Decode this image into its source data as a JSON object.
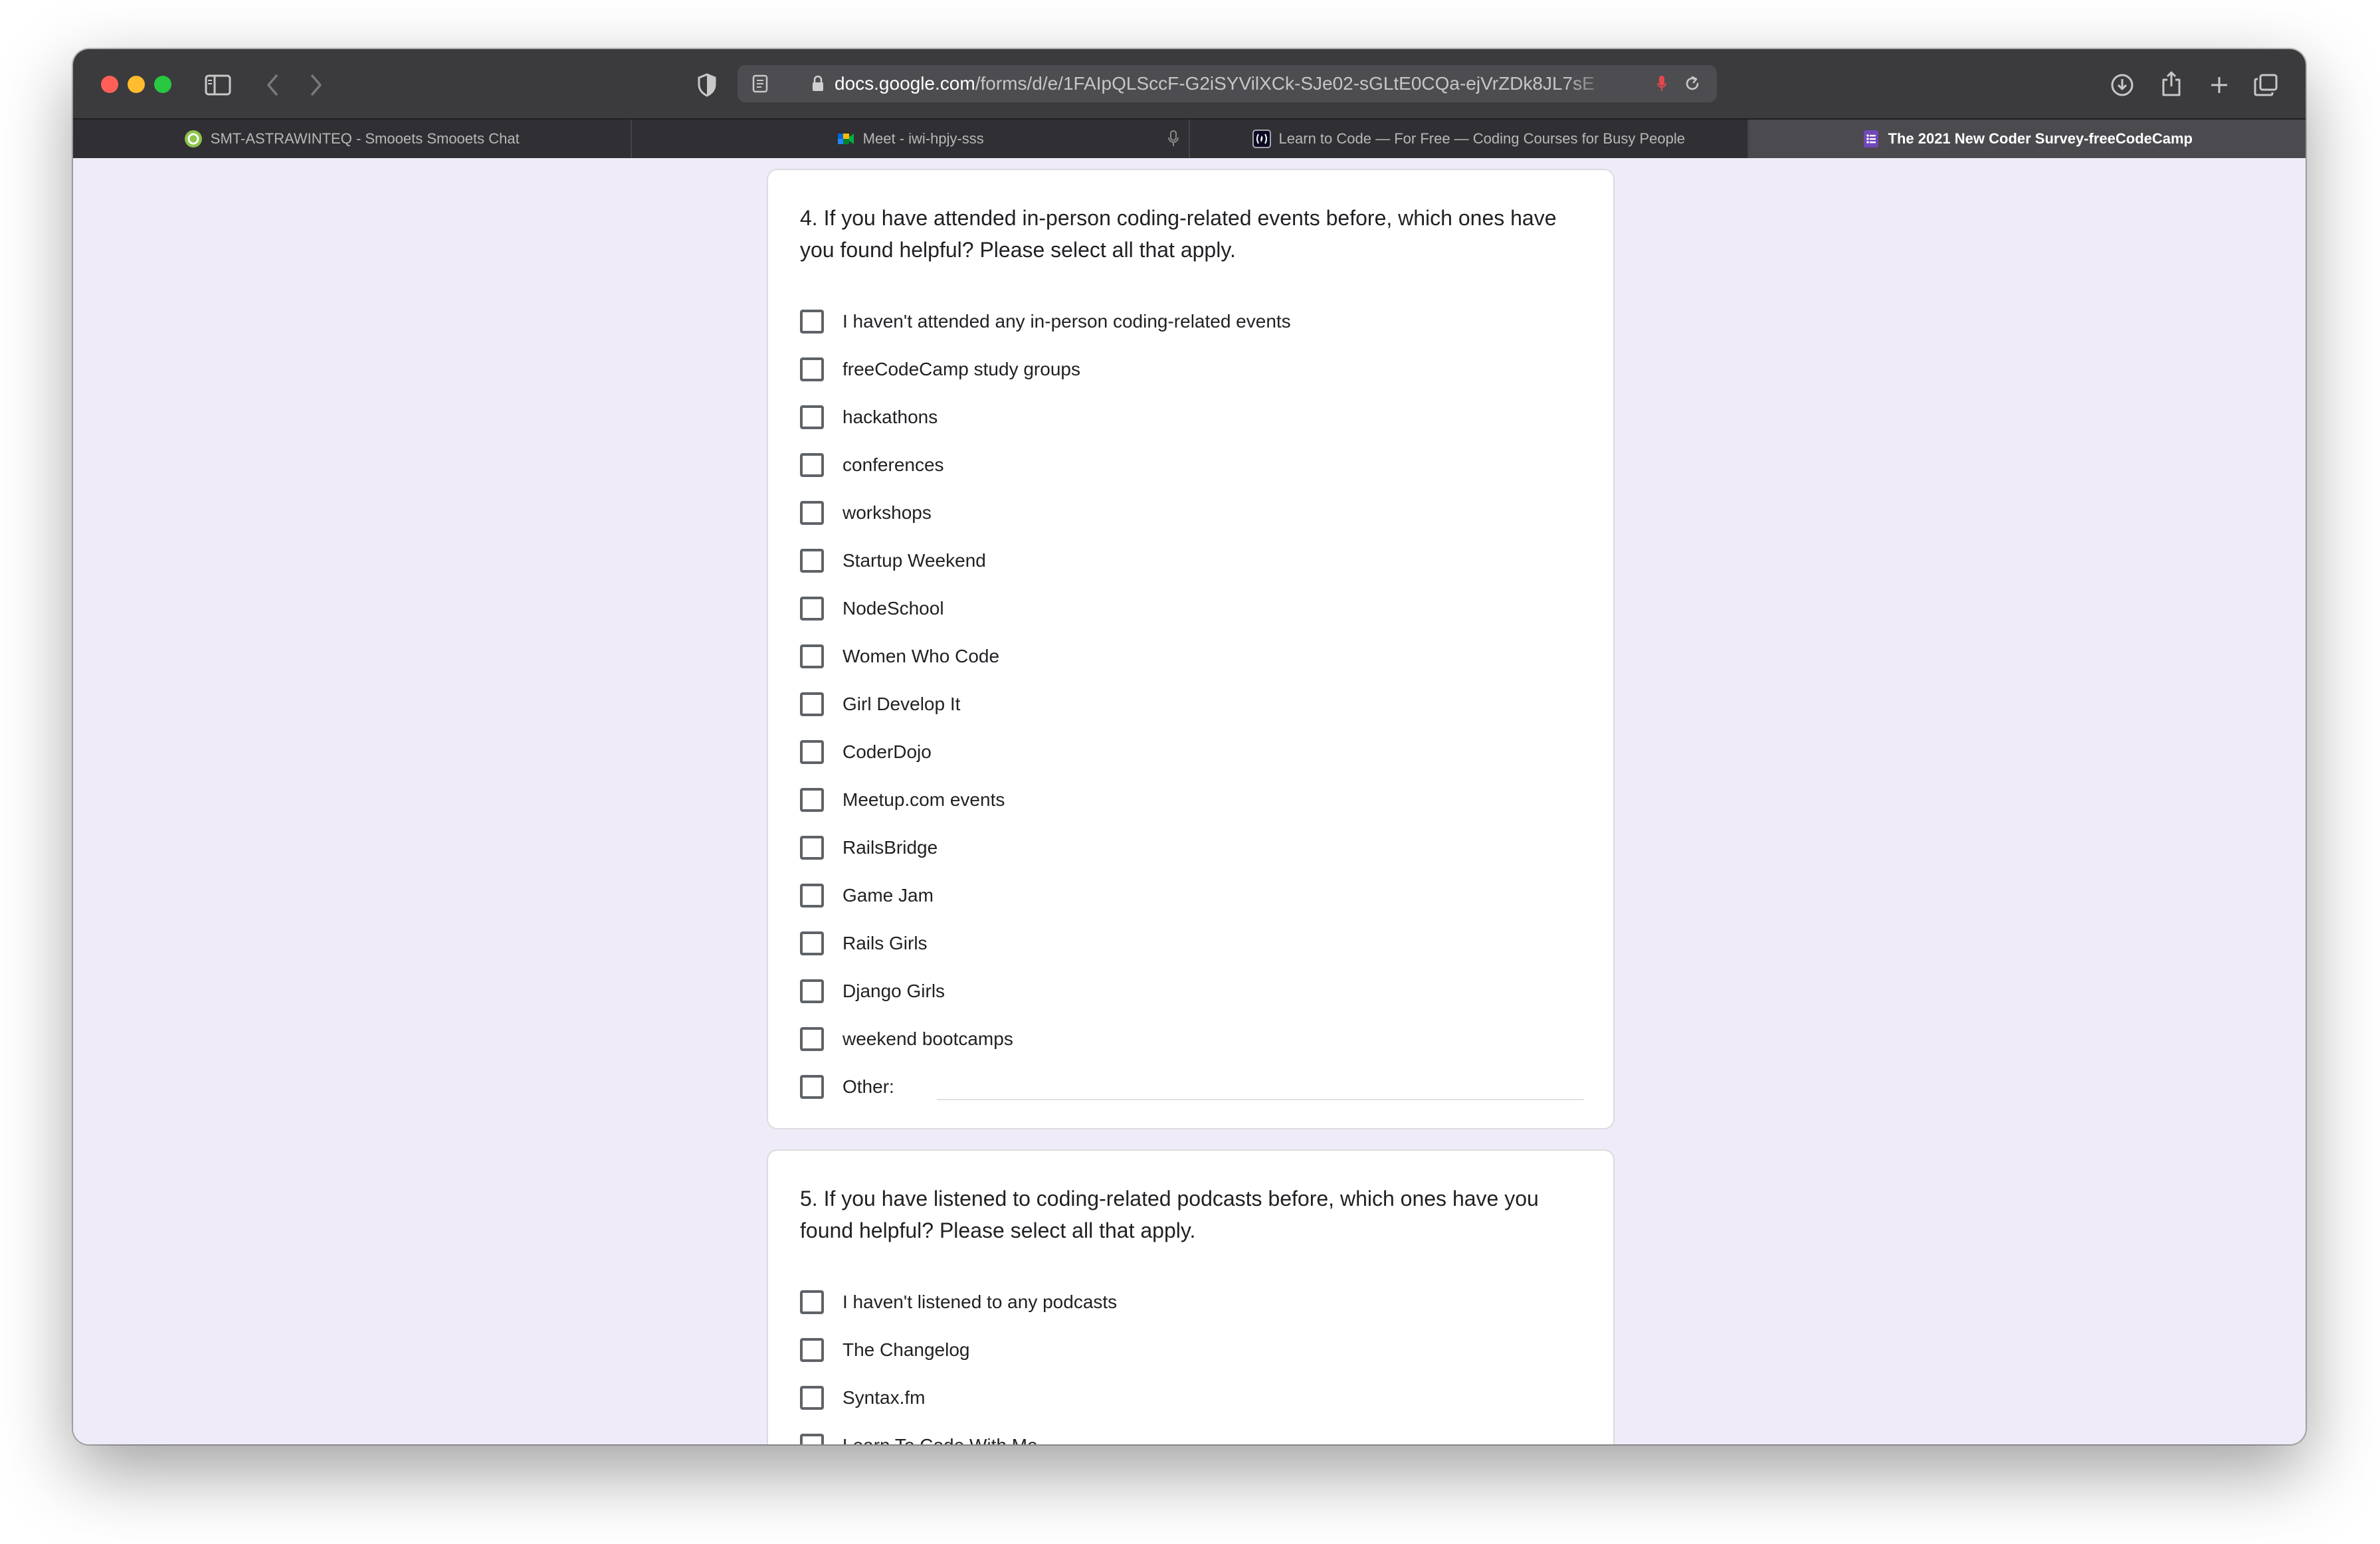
{
  "browser": {
    "url_domain": "docs.google.com",
    "url_path": "/forms/d/e/1FAIpQLSccF-G2iSYVilXCk-SJe02-sGLtE0CQa-ejVrZDk8JL7sE",
    "tabs": [
      {
        "label": "SMT-ASTRAWINTEQ - Smooets Smooets Chat",
        "favicon": "chat-favicon"
      },
      {
        "label": "Meet - iwi-hpjy-sss",
        "favicon": "meet-favicon"
      },
      {
        "label": "Learn to Code — For Free — Coding Courses for Busy People",
        "favicon": "freecodecamp-favicon"
      },
      {
        "label": "The 2021 New Coder Survey-freeCodeCamp",
        "favicon": "forms-favicon",
        "active": true
      }
    ]
  },
  "form": {
    "question4": {
      "title": "4. If you have attended in-person coding-related events before, which ones have you found helpful? Please select all that apply.",
      "options": [
        "I haven't attended any in-person coding-related events",
        "freeCodeCamp study groups",
        "hackathons",
        "conferences",
        "workshops",
        "Startup Weekend",
        "NodeSchool",
        "Women Who Code",
        "Girl Develop It",
        "CoderDojo",
        "Meetup.com events",
        "RailsBridge",
        "Game Jam",
        "Rails Girls",
        "Django Girls",
        "weekend bootcamps",
        "Other:"
      ]
    },
    "question5": {
      "title": "5. If you have listened to coding-related podcasts before, which ones have you found helpful? Please select all that apply.",
      "options": [
        "I haven't listened to any podcasts",
        "The Changelog",
        "Syntax.fm",
        "Learn To Code With Me"
      ]
    }
  },
  "colors": {
    "page_background": "#f0ebf8",
    "card_background": "#ffffff",
    "toolbar": "#3b3a3d",
    "active_tab": "#4b4a4e",
    "checkbox_border": "#5f6368",
    "text": "#202124"
  }
}
